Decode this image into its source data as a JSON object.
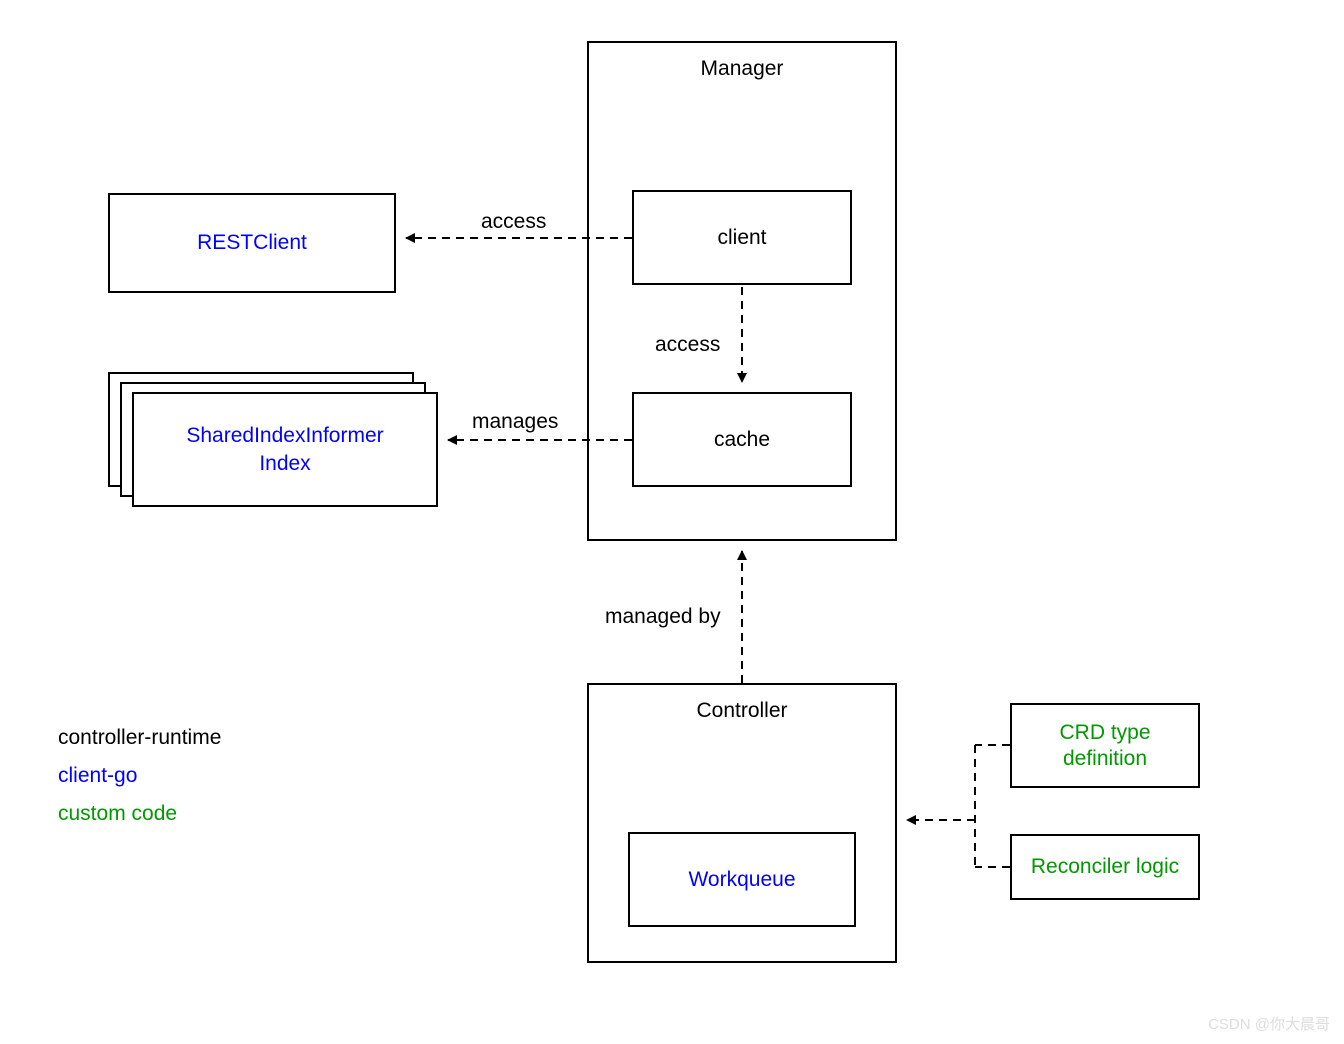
{
  "boxes": {
    "manager": {
      "title": "Manager"
    },
    "client": {
      "label": "client"
    },
    "cache": {
      "label": "cache"
    },
    "restclient": {
      "label": "RESTClient"
    },
    "sharedindex": {
      "line1": "SharedIndexInformer",
      "line2": "Index"
    },
    "controller": {
      "title": "Controller"
    },
    "workqueue": {
      "label": "Workqueue"
    },
    "crdtype": {
      "line1": "CRD type",
      "line2": "definition"
    },
    "reconciler": {
      "label": "Reconciler logic"
    }
  },
  "edges": {
    "access1": "access",
    "access2": "access",
    "manages": "manages",
    "managedby": "managed by"
  },
  "legend": {
    "controller_runtime": "controller-runtime",
    "client_go": "client-go",
    "custom_code": "custom code"
  },
  "watermark": "CSDN @你大晨哥"
}
